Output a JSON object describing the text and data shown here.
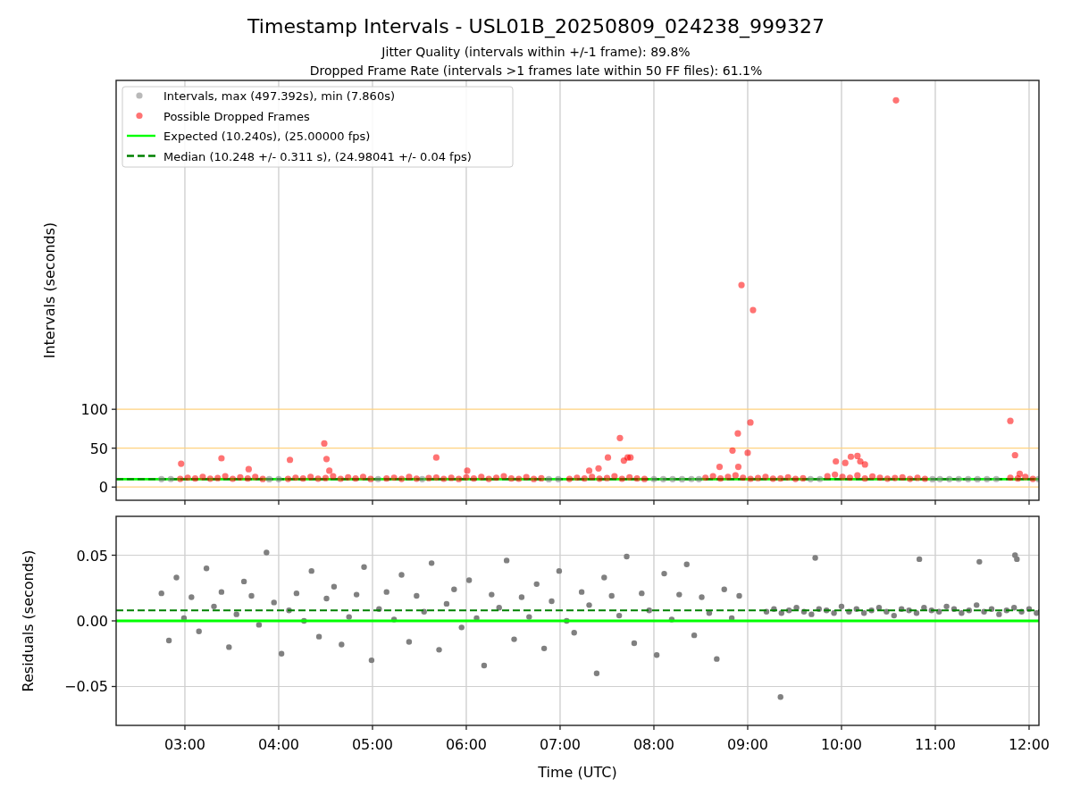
{
  "figure": {
    "title": "Timestamp Intervals - USL01B_20250809_024238_999327",
    "subtitle_lines": [
      "Jitter Quality (intervals within +/-1 frame): 89.8%",
      "Dropped Frame Rate (intervals >1 frames late within 50 FF files): 61.1%"
    ]
  },
  "top_panel": {
    "chart_data": {
      "type": "scatter",
      "ylabel": "Intervals (seconds)",
      "xlim": [
        2.267,
        12.105
      ],
      "ylim": [
        -17,
        523
      ],
      "yticks": [
        {
          "value": 0,
          "label": "0"
        },
        {
          "value": 50,
          "label": "50"
        },
        {
          "value": 100,
          "label": "100"
        }
      ],
      "grid": "both",
      "legend": "upper left",
      "series": [
        {
          "name": "Intervals, max (497.392s), min (7.860s)",
          "type": "scatter",
          "color": "#808080",
          "x": [
            2.75,
            2.85,
            3.9,
            4.0,
            5.06,
            5.53,
            6.88,
            6.98,
            8.0,
            8.1,
            8.2,
            8.3,
            8.4,
            8.48,
            9.67,
            9.77,
            10.97,
            11.05,
            11.15,
            11.25,
            11.35,
            11.45,
            11.55,
            11.65,
            12.1
          ],
          "values": [
            10.2,
            10.3,
            10.1,
            10.2,
            10.3,
            10.2,
            10.1,
            10.2,
            10.3,
            10.2,
            10.2,
            10.1,
            10.3,
            10.2,
            10.2,
            10.3,
            10.1,
            10.2,
            10.2,
            10.3,
            10.2,
            10.1,
            10.2,
            10.3,
            10.2
          ]
        },
        {
          "name": "Possible Dropped Frames",
          "type": "scatter",
          "color": "#ff0000",
          "x": [
            2.95,
            3.03,
            3.11,
            3.19,
            3.27,
            3.35,
            3.43,
            3.51,
            3.59,
            3.67,
            3.75,
            3.83,
            4.1,
            4.18,
            4.26,
            4.34,
            4.42,
            4.5,
            4.58,
            4.66,
            4.74,
            4.82,
            4.9,
            4.98,
            5.15,
            5.23,
            5.31,
            5.39,
            5.47,
            5.6,
            5.68,
            5.76,
            5.84,
            5.92,
            6.0,
            6.08,
            6.16,
            6.24,
            6.32,
            6.4,
            6.48,
            6.56,
            6.64,
            6.72,
            6.8,
            7.1,
            7.18,
            7.26,
            7.34,
            7.42,
            7.5,
            7.58,
            7.66,
            7.74,
            7.82,
            7.9,
            8.55,
            8.63,
            8.71,
            8.79,
            8.87,
            8.95,
            9.03,
            9.11,
            9.19,
            9.27,
            9.35,
            9.43,
            9.51,
            9.59,
            9.85,
            9.93,
            10.01,
            10.09,
            10.17,
            10.25,
            10.33,
            10.41,
            10.49,
            10.57,
            10.65,
            10.73,
            10.81,
            10.89,
            11.8,
            11.88,
            11.96,
            12.04,
            10.581,
            8.934,
            9.057,
            9.029,
            8.895,
            8.838,
            9.0,
            11.8,
            11.85,
            7.638,
            7.72,
            7.75,
            7.68,
            7.51,
            4.486,
            4.51,
            3.39,
            2.96,
            4.12,
            5.68,
            9.94,
            10.04,
            10.1,
            10.17,
            10.25,
            10.2,
            8.7,
            8.9,
            3.68,
            6.01,
            7.31,
            7.41,
            11.9,
            4.54
          ],
          "values": [
            10.5,
            12,
            11,
            13,
            10.8,
            11.5,
            14,
            10.6,
            12.5,
            11,
            13,
            10.4,
            10.5,
            12,
            11,
            13,
            10.8,
            11.5,
            14,
            10.6,
            12.5,
            11,
            13,
            10.4,
            11,
            12,
            10.5,
            13,
            10.8,
            11.5,
            12.2,
            10.6,
            11.8,
            10.4,
            12.5,
            11,
            13,
            10.5,
            12,
            14,
            11,
            10.6,
            12.8,
            10.4,
            11.2,
            10.5,
            12,
            11,
            13,
            10.8,
            11.5,
            14,
            10.6,
            12.5,
            11,
            10.4,
            12,
            14,
            11,
            13,
            15,
            12,
            10.6,
            11.5,
            13,
            10.8,
            11,
            12.4,
            10.5,
            11.2,
            14,
            16,
            13,
            12,
            15,
            11,
            13.5,
            12,
            10.8,
            11.6,
            12.4,
            10.5,
            11.8,
            10.6,
            12,
            11,
            13,
            10.5,
            497.4,
            259.8,
            227.6,
            83,
            69,
            47,
            44,
            85,
            41,
            63,
            38,
            38,
            34,
            38,
            56,
            36,
            37,
            30,
            35,
            38,
            33,
            31,
            39,
            40,
            29,
            33,
            26,
            26,
            23,
            21,
            21,
            24,
            17,
            21
          ]
        },
        {
          "name": "Expected (10.240s), (25.00000 fps)",
          "type": "line",
          "line_style": "solid",
          "color": "#00ff00",
          "x": [
            2.267,
            12.105
          ],
          "values": [
            10.24,
            10.24
          ]
        },
        {
          "name": "Median (10.248 +/- 0.311 s), (24.98041 +/- 0.04 fps)",
          "type": "line",
          "line_style": "dashed",
          "color": "#008000",
          "x": [
            2.267,
            12.105
          ],
          "values": [
            10.248,
            10.248
          ]
        }
      ]
    }
  },
  "bottom_panel": {
    "chart_data": {
      "type": "scatter",
      "xlabel": "Time (UTC)",
      "ylabel": "Residuals (seconds)",
      "xlim": [
        2.267,
        12.105
      ],
      "ylim": [
        -0.0796,
        0.0796
      ],
      "grid": "both",
      "xticks": [
        {
          "value": 3,
          "label": "03:00"
        },
        {
          "value": 4,
          "label": "04:00"
        },
        {
          "value": 5,
          "label": "05:00"
        },
        {
          "value": 6,
          "label": "06:00"
        },
        {
          "value": 7,
          "label": "07:00"
        },
        {
          "value": 8,
          "label": "08:00"
        },
        {
          "value": 9,
          "label": "09:00"
        },
        {
          "value": 10,
          "label": "10:00"
        },
        {
          "value": 11,
          "label": "11:00"
        },
        {
          "value": 12,
          "label": "12:00"
        }
      ],
      "yticks": [
        {
          "value": -0.05,
          "label": "−0.05"
        },
        {
          "value": 0,
          "label": "0.00"
        },
        {
          "value": 0.05,
          "label": "0.05"
        }
      ],
      "series": [
        {
          "type": "scatter",
          "color": "#808080",
          "x": [
            2.75,
            2.83,
            2.91,
            2.99,
            3.07,
            3.15,
            3.23,
            3.31,
            3.39,
            3.47,
            3.55,
            3.63,
            3.71,
            3.79,
            3.87,
            3.95,
            4.03,
            4.11,
            4.19,
            4.27,
            4.35,
            4.43,
            4.51,
            4.59,
            4.67,
            4.75,
            4.83,
            4.91,
            4.99,
            5.07,
            5.15,
            5.23,
            5.31,
            5.39,
            5.47,
            5.55,
            5.63,
            5.71,
            5.79,
            5.87,
            5.95,
            6.03,
            6.11,
            6.19,
            6.27,
            6.35,
            6.43,
            6.51,
            6.59,
            6.67,
            6.75,
            6.83,
            6.91,
            6.99,
            7.07,
            7.15,
            7.23,
            7.31,
            7.39,
            7.47,
            7.55,
            7.63,
            7.71,
            7.79,
            7.87,
            7.95,
            8.03,
            8.11,
            8.19,
            8.27,
            8.35,
            8.43,
            8.51,
            8.59,
            8.67,
            8.75,
            8.83,
            8.91,
            9.2,
            9.28,
            9.36,
            9.44,
            9.52,
            9.6,
            9.68,
            9.76,
            9.84,
            9.92,
            10.0,
            10.08,
            10.16,
            10.24,
            10.32,
            10.4,
            10.48,
            10.56,
            10.64,
            10.72,
            10.8,
            10.88,
            10.96,
            11.04,
            11.12,
            11.2,
            11.28,
            11.36,
            11.44,
            11.52,
            11.6,
            11.68,
            11.76,
            11.84,
            11.92,
            12.0,
            12.08,
            9.35,
            9.72,
            10.83,
            11.47,
            11.85,
            11.87
          ],
          "values": [
            0.021,
            -0.015,
            0.033,
            0.002,
            0.018,
            -0.008,
            0.04,
            0.011,
            0.022,
            -0.02,
            0.005,
            0.03,
            0.019,
            -0.003,
            0.052,
            0.014,
            -0.025,
            0.008,
            0.021,
            0.0,
            0.038,
            -0.012,
            0.017,
            0.026,
            -0.018,
            0.003,
            0.02,
            0.041,
            -0.03,
            0.009,
            0.022,
            0.001,
            0.035,
            -0.016,
            0.019,
            0.007,
            0.044,
            -0.022,
            0.013,
            0.024,
            -0.005,
            0.031,
            0.002,
            -0.034,
            0.02,
            0.01,
            0.046,
            -0.014,
            0.018,
            0.003,
            0.028,
            -0.021,
            0.015,
            0.038,
            0.0,
            -0.009,
            0.022,
            0.012,
            -0.04,
            0.033,
            0.019,
            0.004,
            0.049,
            -0.017,
            0.021,
            0.008,
            -0.026,
            0.036,
            0.001,
            0.02,
            0.043,
            -0.011,
            0.018,
            0.006,
            -0.029,
            0.024,
            0.002,
            0.019,
            0.007,
            0.009,
            0.006,
            0.008,
            0.01,
            0.007,
            0.005,
            0.009,
            0.008,
            0.006,
            0.011,
            0.007,
            0.009,
            0.006,
            0.008,
            0.01,
            0.007,
            0.004,
            0.009,
            0.008,
            0.006,
            0.01,
            0.008,
            0.007,
            0.011,
            0.009,
            0.006,
            0.008,
            0.012,
            0.007,
            0.009,
            0.005,
            0.008,
            0.01,
            0.007,
            0.009,
            0.006,
            -0.058,
            0.048,
            0.047,
            0.045,
            0.05,
            0.047
          ]
        },
        {
          "type": "line",
          "line_style": "solid",
          "color": "#00ff00",
          "x": [
            2.267,
            12.105
          ],
          "values": [
            0,
            0
          ]
        },
        {
          "type": "line",
          "line_style": "dashed",
          "color": "#008000",
          "x": [
            2.267,
            12.105
          ],
          "values": [
            0.008,
            0.008
          ]
        }
      ]
    }
  }
}
